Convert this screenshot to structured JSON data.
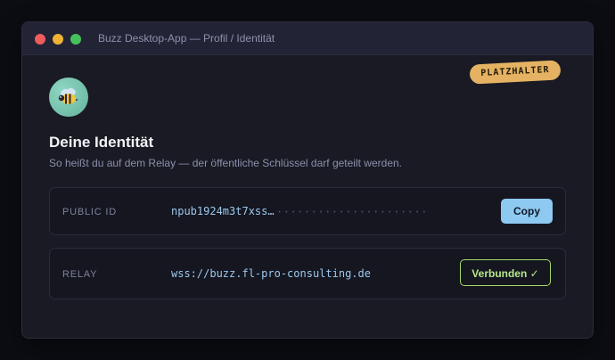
{
  "window": {
    "title": "Buzz Desktop-App — Profil / Identität"
  },
  "badge": {
    "label": "PLATZHALTER"
  },
  "profile": {
    "avatar_icon": "bee-icon",
    "heading": "Deine Identität",
    "subheading": "So heißt du auf dem Relay — der öffentliche Schlüssel darf geteilt werden."
  },
  "public_id": {
    "label": "PUBLIC ID",
    "value": "npub1924m3t7xss…",
    "masked": "······················",
    "copy_label": "Copy"
  },
  "relay": {
    "label": "RELAY",
    "value": "wss://buzz.fl-pro-consulting.de",
    "status_label": "Verbunden ✓"
  },
  "colors": {
    "accent_blue": "#8ec9f2",
    "connected_green": "#a6d96b",
    "badge_gold": "#e4b262"
  }
}
